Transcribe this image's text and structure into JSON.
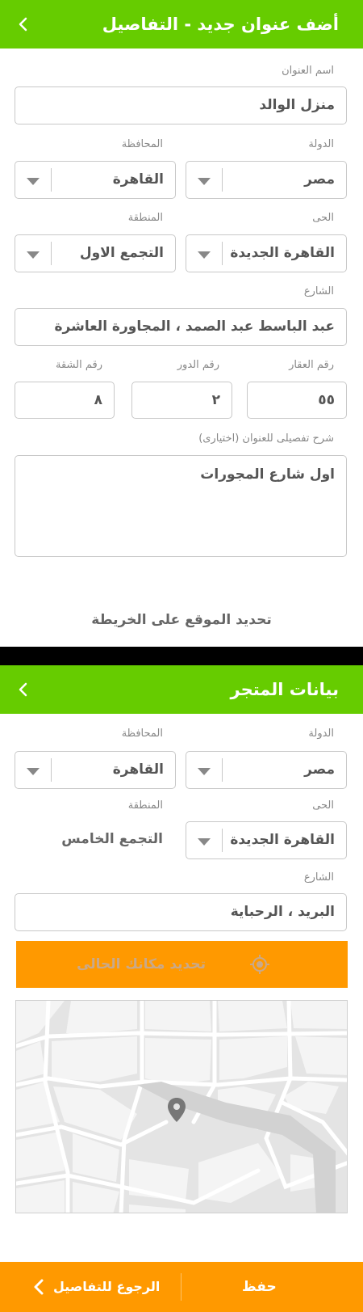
{
  "screen1": {
    "title": "أضف عنوان جديد - التفاصيل",
    "address_name_label": "اسم العنوان",
    "address_name_value": "منزل الوالد",
    "country_label": "الدولة",
    "country_value": "مصر",
    "governorate_label": "المحافظة",
    "governorate_value": "القاهرة",
    "district_label": "الحى",
    "district_value": "القاهرة الجديدة",
    "area_label": "المنطقة",
    "area_value": "التجمع الاول",
    "street_label": "الشارع",
    "street_value": "عبد الباسط عبد الصمد ، المجاورة العاشرة",
    "building_label": "رقم العقار",
    "building_value": "٥٥",
    "floor_label": "رقم الدور",
    "floor_value": "٢",
    "apartment_label": "رقم الشقة",
    "apartment_value": "٨",
    "details_label": "شرح تفصيلى للعنوان (اختيارى)",
    "details_value": "اول شارع المجورات",
    "map_link": "تحديد الموقع على الخريطة"
  },
  "screen2": {
    "title": "بيانات المتجر",
    "country_label": "الدولة",
    "country_value": "مصر",
    "governorate_label": "المحافظة",
    "governorate_value": "القاهرة",
    "district_label": "الحى",
    "district_value": "القاهرة الجديدة",
    "area_label": "المنطقة",
    "area_value": "التجمع الخامس",
    "street_label": "الشارع",
    "street_value": "البريد ، الرحباية",
    "locate_button": "تحديد مكانك الحالى",
    "save_button": "حفظ",
    "back_to_details": "الرجوع للتفاصيل"
  },
  "colors": {
    "header_green": "#66cc00",
    "accent_orange": "#ff9900",
    "border_gray": "#c8c8c8",
    "map_pin": "#777777"
  },
  "icons": [
    "chevron-left-icon",
    "caret-down-icon",
    "crosshair-icon",
    "map-pin-icon"
  ]
}
